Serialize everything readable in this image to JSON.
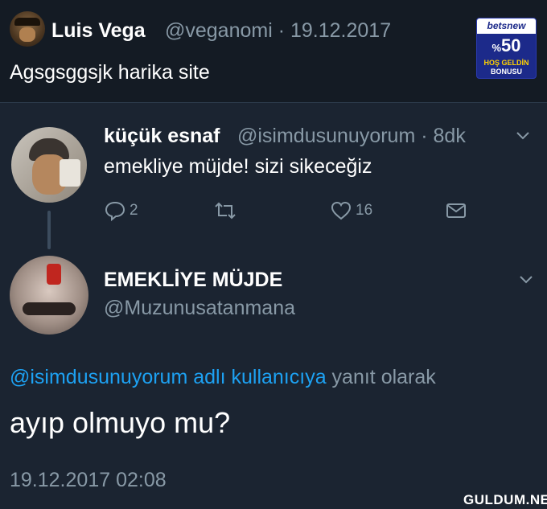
{
  "top_tweet": {
    "name": "Luis Vega",
    "meta": "@veganomi · 19.12.2017",
    "text": "Agsgsggsjk harika site"
  },
  "ad": {
    "brand": "betsnew",
    "percent_symbol": "%",
    "percent_value": "50",
    "line1": "HOŞ GELDİN",
    "line2": "BONUSU",
    "colors": {
      "background": "#1c2a8a",
      "accent": "#ffd200"
    }
  },
  "tweet1": {
    "name": "küçük esnaf",
    "meta": "@isimdusunuyorum · 8dk",
    "text": "emekliye müjde! sizi sikeceğiz",
    "replies": "2",
    "likes": "16",
    "icons": [
      "reply-icon",
      "retweet-icon",
      "like-icon",
      "message-icon",
      "chevron-down-icon"
    ]
  },
  "tweet2": {
    "name": "EMEKLİYE MÜJDE",
    "handle": "@Muzunusatanmana",
    "reply_link": "@isimdusunuyorum adlı kullanıcıya",
    "reply_suffix": " yanıt olarak",
    "text": "ayıp olmuyo mu?",
    "date": "19.12.2017 02:08"
  },
  "watermark": "GULDUM.NET",
  "colors": {
    "background": "#1b2431",
    "header_background": "#141b24",
    "muted": "#8899a6",
    "link": "#1da1f2"
  }
}
